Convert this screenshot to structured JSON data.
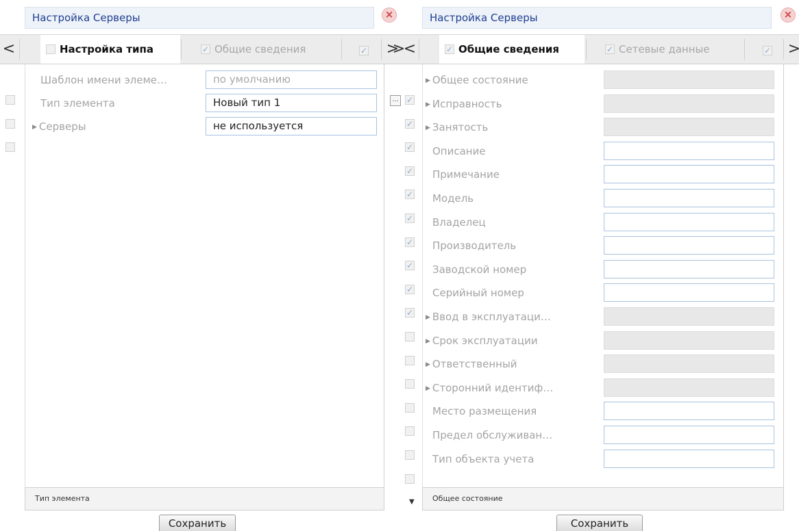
{
  "left": {
    "title": "Настройка Серверы",
    "close_symbol": "×",
    "nav_prev": "<",
    "tabs": [
      {
        "label": "Настройка типа",
        "checked": false,
        "active": true
      },
      {
        "label": "Общие сведения",
        "checked": true,
        "active": false
      }
    ],
    "tab_tail_checked": true,
    "nav_next": ">",
    "rows": [
      {
        "label": "Шаблон имени элеме…",
        "value": "по умолчанию",
        "placeholder": true,
        "checked": false
      },
      {
        "label": "Тип элемента",
        "value": "Новый тип 1",
        "placeholder": false,
        "checked": false
      },
      {
        "label": "Серверы",
        "value": "не используется",
        "placeholder": false,
        "checked": false,
        "expandable": true
      }
    ],
    "status": "Тип элемента",
    "save_label": "Сохранить"
  },
  "right": {
    "title": "Настройка Серверы",
    "close_symbol": "×",
    "nav_prev": "<",
    "tabs": [
      {
        "label": "Общие сведения",
        "checked": true,
        "active": true
      },
      {
        "label": "Сетевые данные",
        "checked": true,
        "active": false
      }
    ],
    "tab_tail_checked": true,
    "nav_next": ">",
    "collapse_symbol": "…",
    "scroll_down_symbol": "▼",
    "rows": [
      {
        "label": "Общее состояние",
        "checked": true,
        "expandable": true,
        "disabled": true
      },
      {
        "label": "Исправность",
        "checked": true,
        "expandable": true,
        "disabled": true
      },
      {
        "label": "Занятость",
        "checked": true,
        "expandable": true,
        "disabled": true
      },
      {
        "label": "Описание",
        "checked": true,
        "expandable": false,
        "disabled": false
      },
      {
        "label": "Примечание",
        "checked": true,
        "expandable": false,
        "disabled": false
      },
      {
        "label": "Модель",
        "checked": true,
        "expandable": false,
        "disabled": false
      },
      {
        "label": "Владелец",
        "checked": true,
        "expandable": false,
        "disabled": false
      },
      {
        "label": "Производитель",
        "checked": true,
        "expandable": false,
        "disabled": false
      },
      {
        "label": "Заводской номер",
        "checked": true,
        "expandable": false,
        "disabled": false
      },
      {
        "label": "Серийный номер",
        "checked": true,
        "expandable": false,
        "disabled": false
      },
      {
        "label": "Ввод в эксплуатаци…",
        "checked": false,
        "expandable": true,
        "disabled": true
      },
      {
        "label": "Срок эксплуатации",
        "checked": false,
        "expandable": true,
        "disabled": true
      },
      {
        "label": "Ответственный",
        "checked": false,
        "expandable": true,
        "disabled": true
      },
      {
        "label": "Сторонний идентиф…",
        "checked": false,
        "expandable": true,
        "disabled": true
      },
      {
        "label": "Место размещения",
        "checked": false,
        "expandable": false,
        "disabled": false
      },
      {
        "label": "Предел обслуживан…",
        "checked": false,
        "expandable": false,
        "disabled": false
      },
      {
        "label": "Тип объекта учета",
        "checked": false,
        "expandable": false,
        "disabled": false
      }
    ],
    "status": "Общее состояние",
    "save_label": "Сохранить"
  },
  "colors": {
    "title_text": "#1f3f91",
    "field_border": "#a7c2e0",
    "checkbox_check": "#3b6fb6"
  },
  "icons": {
    "close": "close-icon",
    "expand": "triangle-right-icon",
    "collapse": "collapse-icon",
    "scroll_down": "chevron-down-icon"
  }
}
